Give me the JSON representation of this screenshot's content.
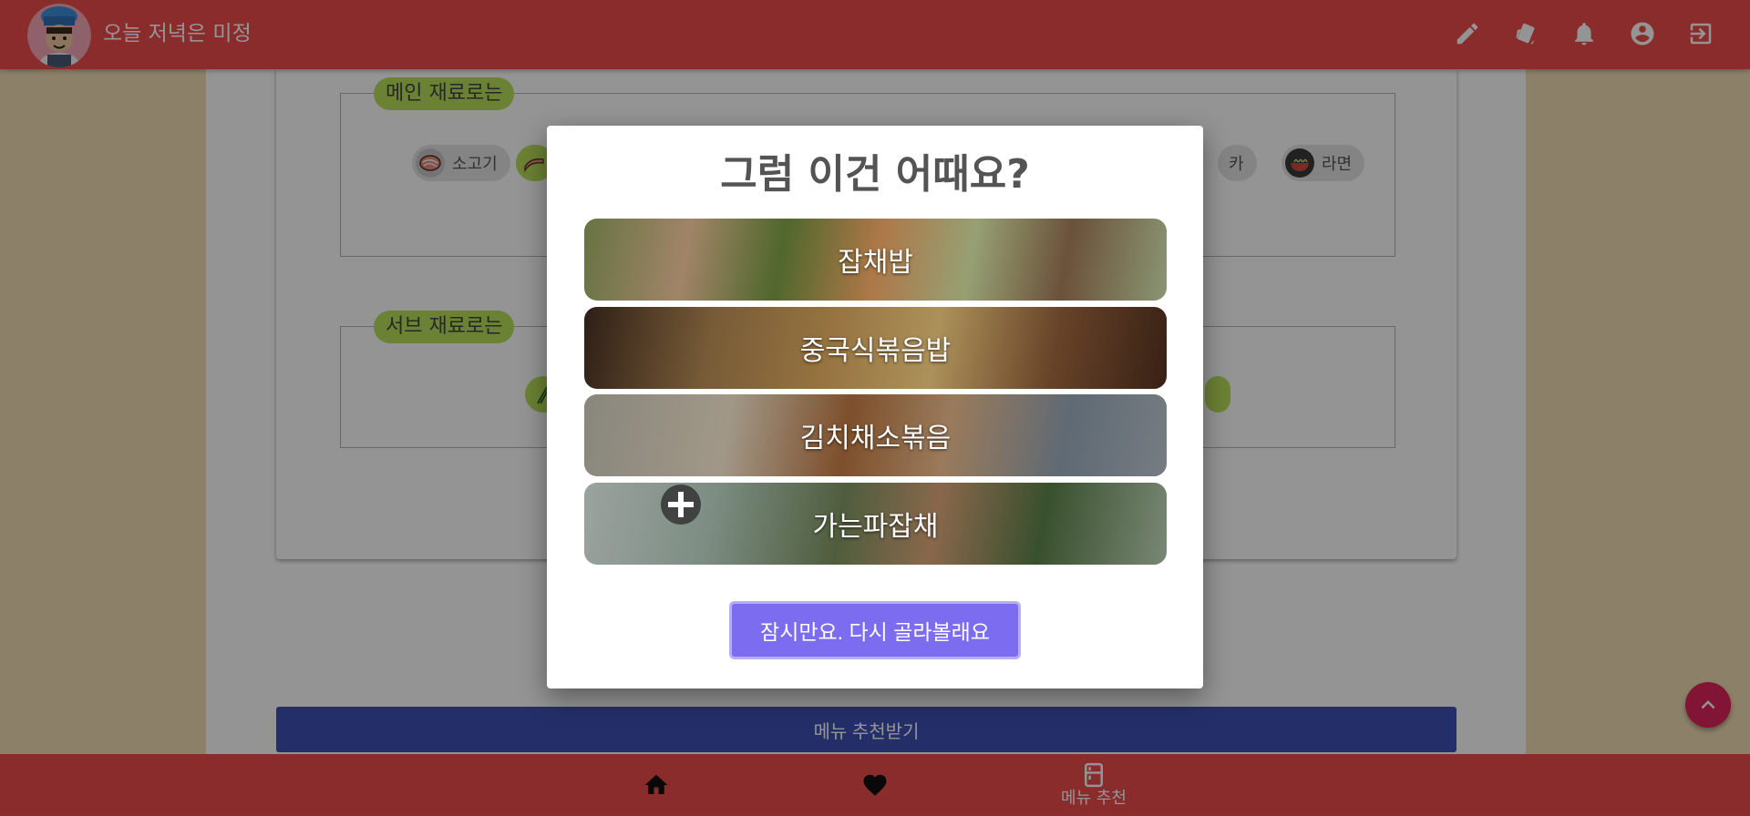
{
  "app": {
    "title": "오늘 저녁은 미정",
    "logo_icon": "chef-avatar-icon"
  },
  "toolbar": {
    "actions": [
      {
        "name": "edit-button",
        "icon": "pencil-icon"
      },
      {
        "name": "cards-button",
        "icon": "cards-icon"
      },
      {
        "name": "notifications-button",
        "icon": "bell-icon"
      },
      {
        "name": "account-button",
        "icon": "account-circle-icon"
      },
      {
        "name": "logout-button",
        "icon": "exit-icon"
      }
    ]
  },
  "main_section": {
    "legend": "메인 재료로는",
    "chips": [
      {
        "label": "소고기",
        "icon": "beef-icon",
        "selected": false
      },
      {
        "label": "",
        "icon": "bacon-icon",
        "selected": true
      },
      {
        "label": "카",
        "icon": "",
        "selected": false
      },
      {
        "label": "라면",
        "icon": "ramen-icon",
        "selected": false
      }
    ]
  },
  "sub_section": {
    "legend": "서브 재료로는"
  },
  "submit": {
    "label": "메뉴 추천받기"
  },
  "bottom_nav": {
    "items": [
      {
        "label": "",
        "icon": "home-icon"
      },
      {
        "label": "",
        "icon": "heart-icon"
      },
      {
        "label": "메뉴 추천",
        "icon": "fridge-icon",
        "active": true
      }
    ]
  },
  "modal": {
    "title": "그럼 이건 어때요?",
    "options": [
      {
        "label": "잡채밥"
      },
      {
        "label": "중국식볶음밥"
      },
      {
        "label": "김치채소볶음"
      },
      {
        "label": "가는파잡채"
      }
    ],
    "retry_label": "잠시만요. 다시 골라볼래요"
  },
  "colors": {
    "primary": "#ee4d4d",
    "accent_green": "#b8e05a",
    "submit_blue": "#3f51b5",
    "fab_pink": "#e0245e",
    "modal_button": "#7b6cf0"
  }
}
